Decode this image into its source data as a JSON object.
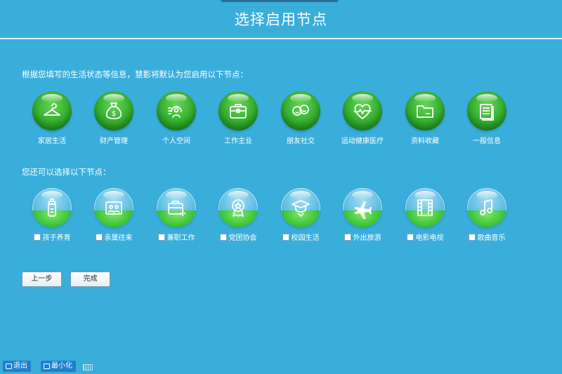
{
  "header": {
    "title": "选择启用节点"
  },
  "default_section": {
    "label": "根据您填写的生活状态等信息，慧影将默认为您启用以下节点：",
    "nodes": [
      {
        "label": "家居生活",
        "icon": "hanger-icon"
      },
      {
        "label": "财产管理",
        "icon": "money-bag-icon"
      },
      {
        "label": "个人空间",
        "icon": "personal-space-icon"
      },
      {
        "label": "工作主业",
        "icon": "briefcase-icon"
      },
      {
        "label": "朋友社交",
        "icon": "chat-faces-icon"
      },
      {
        "label": "运动健康医疗",
        "icon": "heartbeat-icon"
      },
      {
        "label": "资料收藏",
        "icon": "folder-icon"
      },
      {
        "label": "一般信息",
        "icon": "documents-icon"
      }
    ]
  },
  "optional_section": {
    "label": "您还可以选择以下节点：",
    "nodes": [
      {
        "label": "孩子养育",
        "icon": "baby-bottle-icon",
        "checked": false
      },
      {
        "label": "亲属往来",
        "icon": "family-photo-icon",
        "checked": false
      },
      {
        "label": "兼职工作",
        "icon": "briefcase-plus-icon",
        "checked": false
      },
      {
        "label": "党团协会",
        "icon": "badge-star-icon",
        "checked": false
      },
      {
        "label": "校园生活",
        "icon": "graduation-cap-icon",
        "checked": false
      },
      {
        "label": "外出旅游",
        "icon": "airplane-icon",
        "checked": false
      },
      {
        "label": "电影电视",
        "icon": "film-strip-icon",
        "checked": false
      },
      {
        "label": "歌曲音乐",
        "icon": "music-note-icon",
        "checked": false
      }
    ]
  },
  "actions": {
    "prev_label": "上一步",
    "finish_label": "完成"
  },
  "bottom_bar": {
    "exit_label": "退出",
    "minimize_label": "最小化",
    "keyboard_icon": "keyboard-icon"
  },
  "colors": {
    "background": "#3aaedb",
    "orb_green": "#33ae2e",
    "button_blue": "#1f7fcc"
  }
}
